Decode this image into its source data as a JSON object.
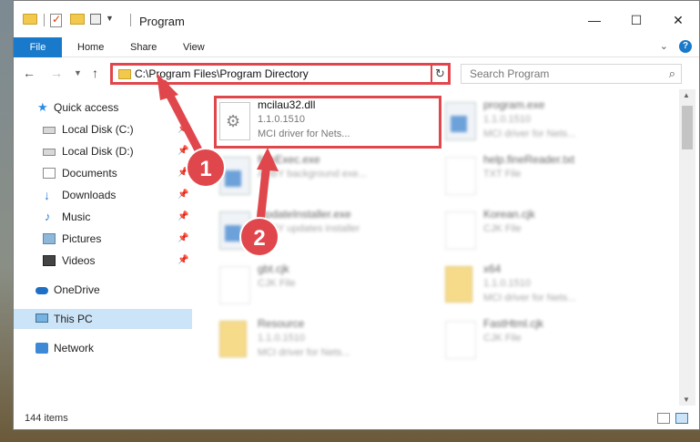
{
  "window": {
    "title": "Program"
  },
  "ribbon": {
    "tabs": [
      "File",
      "Home",
      "Share",
      "View"
    ]
  },
  "nav": {
    "address": "C:\\Program Files\\Program Directory",
    "search_placeholder": "Search Program"
  },
  "sidebar": {
    "items": [
      {
        "label": "Quick access",
        "icon": "star-icon"
      },
      {
        "label": "Local Disk (C:)",
        "icon": "drive-icon",
        "pinned": true
      },
      {
        "label": "Local Disk (D:)",
        "icon": "drive-icon",
        "pinned": true
      },
      {
        "label": "Documents",
        "icon": "documents-icon",
        "pinned": true
      },
      {
        "label": "Downloads",
        "icon": "download-arrow-icon",
        "pinned": true
      },
      {
        "label": "Music",
        "icon": "music-note-icon",
        "pinned": true
      },
      {
        "label": "Pictures",
        "icon": "pictures-icon",
        "pinned": true
      },
      {
        "label": "Videos",
        "icon": "film-icon",
        "pinned": true
      },
      {
        "label": "OneDrive",
        "icon": "cloud-icon"
      },
      {
        "label": "This PC",
        "icon": "computer-icon",
        "selected": true
      },
      {
        "label": "Network",
        "icon": "network-icon"
      }
    ]
  },
  "files": [
    {
      "name": "mcilau32.dll",
      "line2": "1.1.0.1510",
      "line3": "MCI driver for Nets...",
      "icon": "dll-gear-icon",
      "highlighted": true
    },
    {
      "name": "program.exe",
      "line2": "1.1.0.1510",
      "line3": "MCI driver for Nets...",
      "icon": "exe-icon"
    },
    {
      "name": "fineExec.exe",
      "line2": "ABBY background exe...",
      "line3": "",
      "icon": "exe-icon"
    },
    {
      "name": "help.fineReader.txt",
      "line2": "TXT File",
      "line3": "",
      "icon": "text-file-icon"
    },
    {
      "name": "UpdateInstaller.exe",
      "line2": "ABBY updates installer",
      "line3": "",
      "icon": "exe-icon"
    },
    {
      "name": "Korean.cjk",
      "line2": "CJK File",
      "line3": "",
      "icon": "text-file-icon"
    },
    {
      "name": "gbt.cjk",
      "line2": "CJK File",
      "line3": "",
      "icon": "text-file-icon"
    },
    {
      "name": "x64",
      "line2": "1.1.0.1510",
      "line3": "MCI driver for Nets...",
      "icon": "folder-icon"
    },
    {
      "name": "Resource",
      "line2": "1.1.0.1510",
      "line3": "MCI driver for Nets...",
      "icon": "folder-icon"
    },
    {
      "name": "FastHtml.cjk",
      "line2": "CJK File",
      "line3": "",
      "icon": "text-file-icon"
    }
  ],
  "status": {
    "item_count": "144 items"
  },
  "callouts": [
    "1",
    "2"
  ],
  "colors": {
    "accent": "#1979ca",
    "callout_red": "#e0474c",
    "selected_bg": "#cce4f7"
  }
}
